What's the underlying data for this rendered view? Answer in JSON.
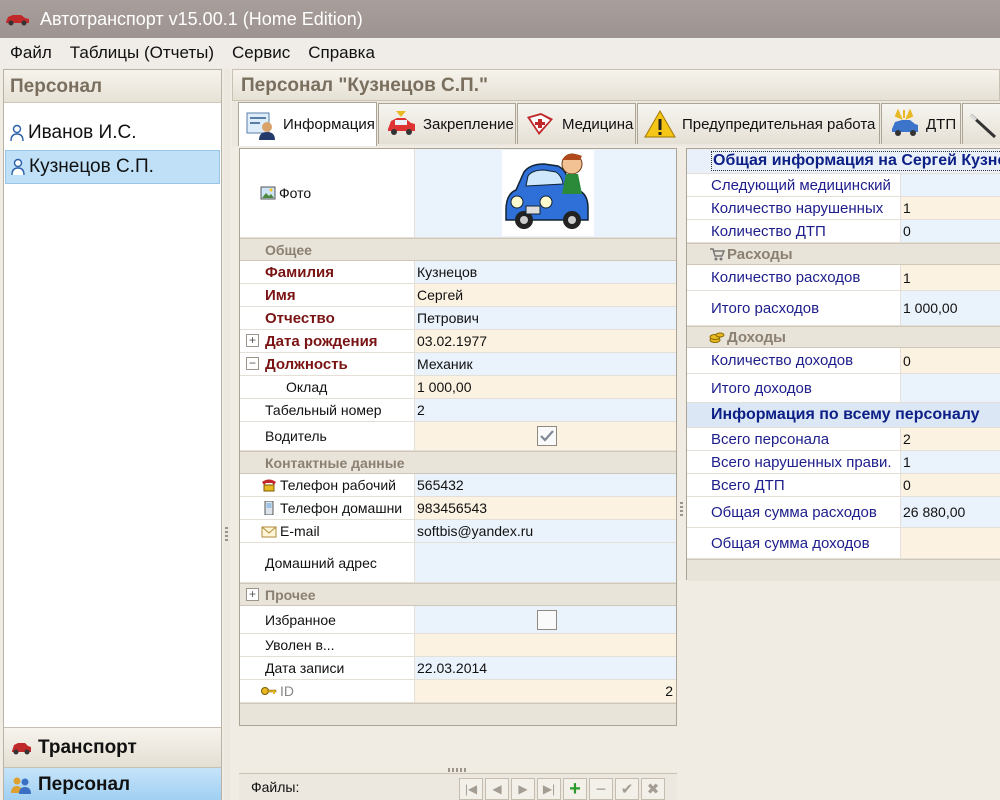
{
  "window": {
    "title": "Автотранспорт v15.00.1 (Home Edition)"
  },
  "menu": [
    "Файл",
    "Таблицы (Отчеты)",
    "Сервис",
    "Справка"
  ],
  "left": {
    "header": "Персонал",
    "people": [
      "Иванов И.С.",
      "Кузнецов С.П."
    ],
    "nav": [
      "Транспорт",
      "Персонал"
    ]
  },
  "main": {
    "header": "Персонал \"Кузнецов С.П.\"",
    "tabs": [
      "Информация",
      "Закрепление",
      "Медицина",
      "Предупредительная работа",
      "ДТП"
    ]
  },
  "form": {
    "photo_label": "Фото",
    "general_group": "Общее",
    "surname_label": "Фамилия",
    "surname": "Кузнецов",
    "name_label": "Имя",
    "name": "Сергей",
    "patronymic_label": "Отчество",
    "patronymic": "Петрович",
    "birth_label": "Дата рождения",
    "birth": "03.02.1977",
    "position_label": "Должность",
    "position": "Механик",
    "salary_label": "Оклад",
    "salary": "1 000,00",
    "tabnum_label": "Табельный номер",
    "tabnum": "2",
    "driver_label": "Водитель",
    "driver_checked": true,
    "contacts_group": "Контактные данные",
    "work_phone_label": "Телефон рабочий",
    "work_phone": "565432",
    "home_phone_label": "Телефон домашни",
    "home_phone": "983456543",
    "email_label": "E-mail",
    "email": "softbis@yandex.ru",
    "address_label": "Домашний адрес",
    "address": "",
    "other_group": "Прочее",
    "favorite_label": "Избранное",
    "favorite_checked": false,
    "fired_label": "Уволен в...",
    "fired": "",
    "record_date_label": "Дата записи",
    "record_date": "22.03.2014",
    "id_label": "ID",
    "id": "2"
  },
  "files": {
    "label": "Файлы:"
  },
  "summary": {
    "title": "Общая информация на Сергей Кузнецов",
    "next_med_label": "Следующий медицинский",
    "next_med": "",
    "violations_label": "Количество нарушенных",
    "violations": "1",
    "accidents_label": "Количество ДТП",
    "accidents": "0",
    "expenses_group": "Расходы",
    "expense_count_label": "Количество расходов",
    "expense_count": "1",
    "expense_total_label": "Итого расходов",
    "expense_total": "1 000,00",
    "income_group": "Доходы",
    "income_count_label": "Количество доходов",
    "income_count": "0",
    "income_total_label": "Итого доходов",
    "income_total": "",
    "all_title": "Информация по всему персоналу",
    "all_staff_label": "Всего персонала",
    "all_staff": "2",
    "all_violations_label": "Всего нарушенных прави.",
    "all_violations": "1",
    "all_accidents_label": "Всего ДТП",
    "all_accidents": "0",
    "all_expenses_label": "Общая сумма расходов",
    "all_expenses": "26 880,00",
    "all_income_label": "Общая сумма доходов",
    "all_income": ""
  }
}
